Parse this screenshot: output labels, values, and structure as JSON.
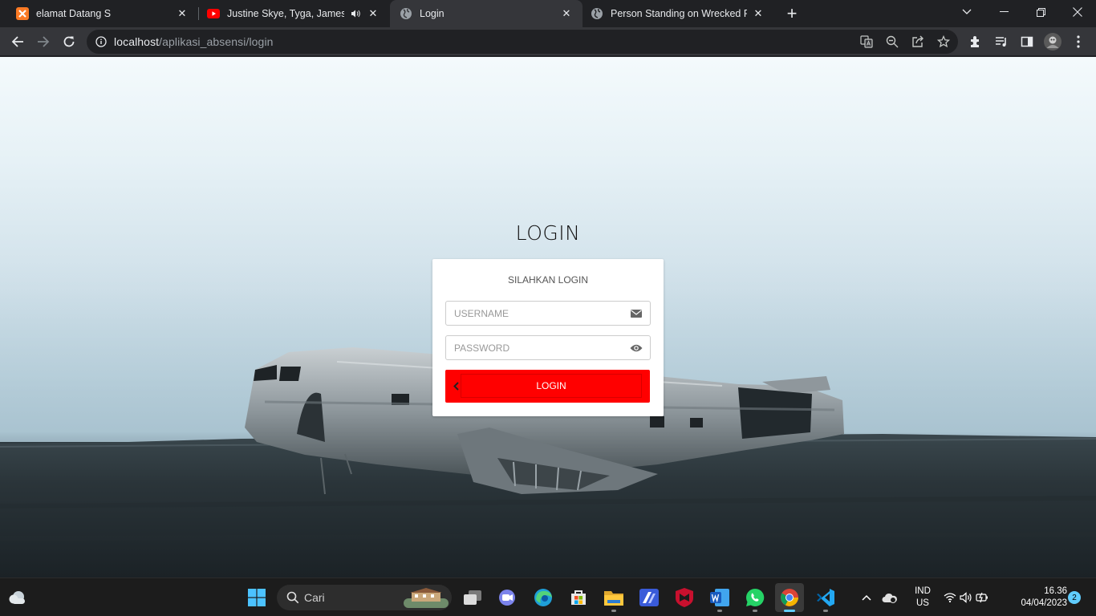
{
  "browser": {
    "tabs": [
      {
        "title": "elamat Datang S",
        "icon": "xampp-icon",
        "active": false
      },
      {
        "title": "Justine Skye, Tyga, James Arth",
        "icon": "youtube-icon",
        "active": false,
        "playing_audio": true
      },
      {
        "title": "Login",
        "icon": "globe-icon",
        "active": true
      },
      {
        "title": "Person Standing on Wrecked Plan",
        "icon": "globe-icon",
        "active": false
      }
    ],
    "url_host": "localhost",
    "url_path": "/aplikasi_absensi/login"
  },
  "page": {
    "heading": "LOGIN",
    "card_subtitle": "SILAHKAN LOGIN",
    "username_placeholder": "USERNAME",
    "password_placeholder": "PASSWORD",
    "login_button": "LOGIN"
  },
  "taskbar": {
    "search_label": "Cari",
    "lang_line1": "IND",
    "lang_line2": "US",
    "time": "16.36",
    "date": "04/04/2023",
    "notification_count": "2"
  },
  "colors": {
    "accent_button": "#ff0000",
    "browser_dark": "#202124",
    "taskbar_accent": "#60cdff"
  }
}
